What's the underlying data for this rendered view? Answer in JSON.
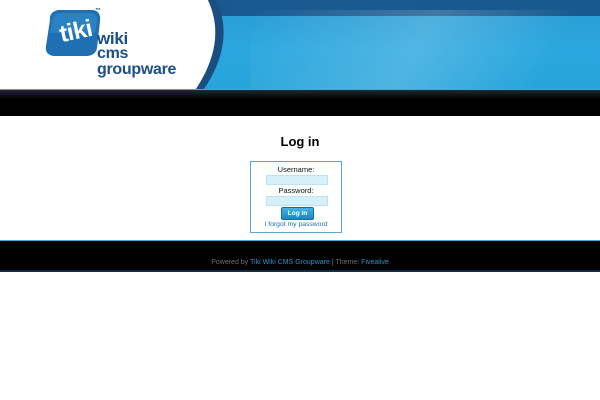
{
  "header": {
    "logo": {
      "badge_text": "tiki",
      "trademark": "™",
      "word_1": "wiki",
      "word_2": "cms",
      "word_3": "groupware"
    }
  },
  "login": {
    "title": "Log in",
    "username_label": "Username:",
    "username_value": "",
    "password_label": "Password:",
    "password_value": "",
    "submit_label": "Log in",
    "forgot_link": "I forgot my password"
  },
  "footer": {
    "powered_prefix": "Powered by",
    "powered_link": "Tiki Wiki CMS Groupware",
    "separator": "|",
    "theme_prefix": "Theme:",
    "theme_link": "Fivealive"
  },
  "colors": {
    "brand_dark_blue": "#1b4f86",
    "brand_light_blue": "#2aa7de",
    "link_blue": "#1d6fa8",
    "field_bg": "#d6f0fa"
  }
}
